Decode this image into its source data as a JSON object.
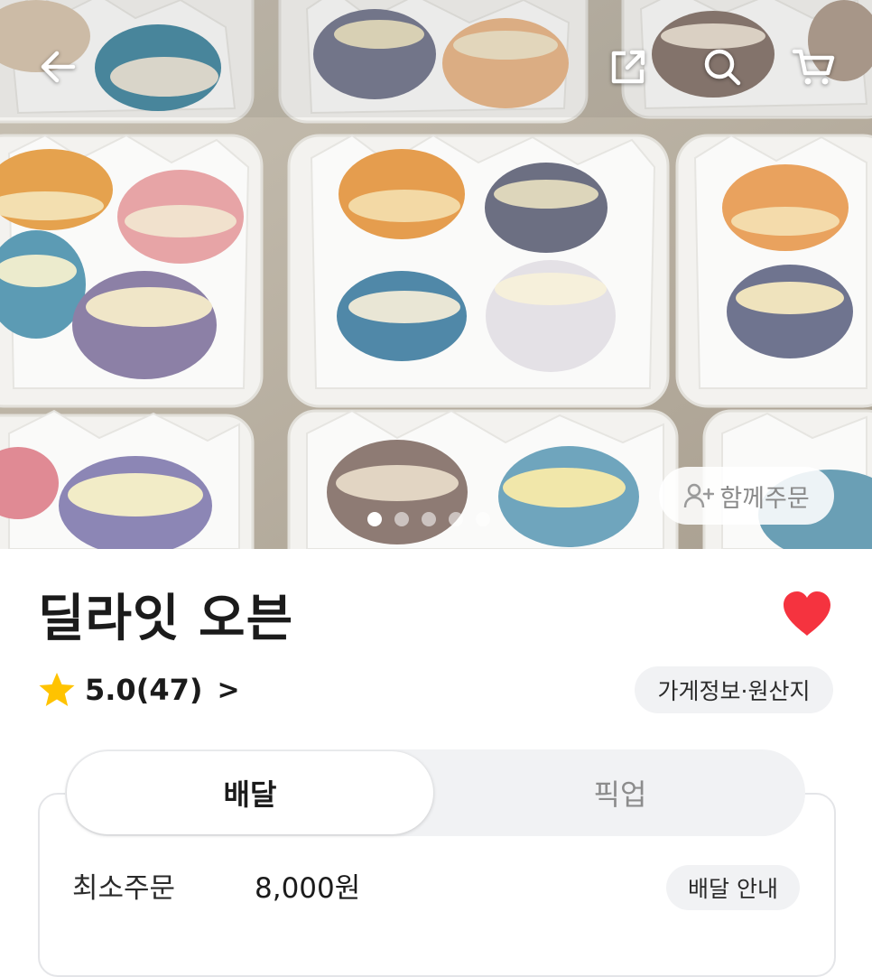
{
  "hero": {
    "image_alt": "macarons in white paper liners",
    "carousel": {
      "count": 5,
      "active_index": 0
    },
    "group_order_label": "함께주문"
  },
  "topbar": {
    "icons": [
      "back-arrow-icon",
      "share-icon",
      "search-icon",
      "cart-icon"
    ]
  },
  "store": {
    "name": "딜라잇 오븐",
    "favorite": true,
    "rating_text": "5.0(47)",
    "rating_chevron": ">",
    "info_chip": "가게정보·원산지"
  },
  "order": {
    "tabs": [
      {
        "label": "배달",
        "active": true
      },
      {
        "label": "픽업",
        "active": false
      }
    ],
    "min_order_label": "최소주문",
    "min_order_value": "8,000원",
    "delivery_info_chip": "배달 안내"
  },
  "colors": {
    "heart": "#f5333f",
    "star": "#ffc300",
    "chip_bg": "#f1f2f4",
    "panel_border": "#e4e5e8"
  }
}
